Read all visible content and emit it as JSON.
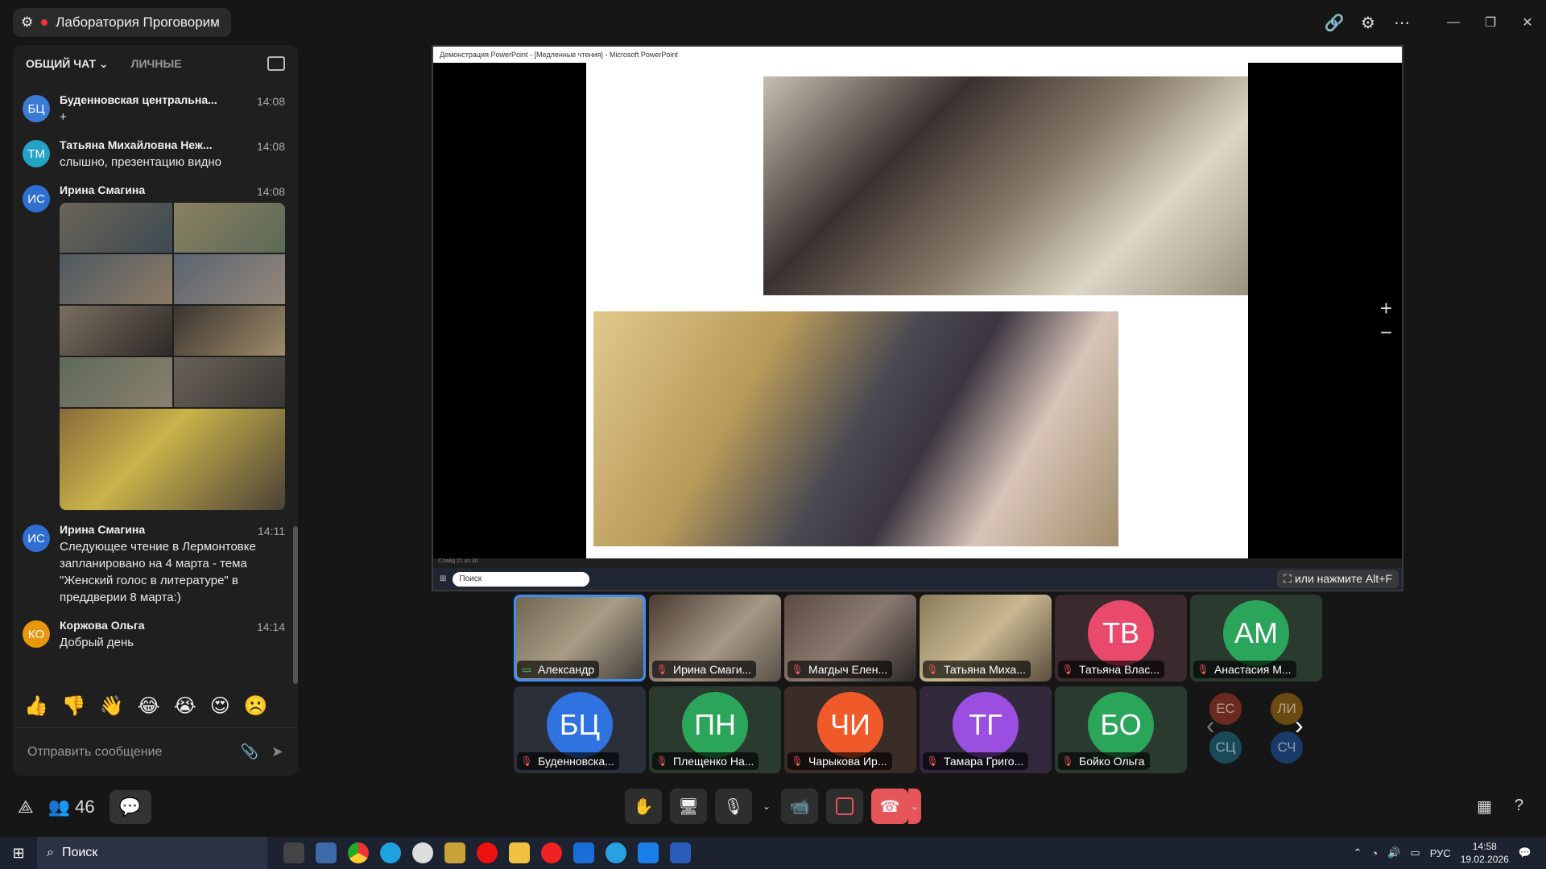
{
  "room": {
    "title": "Лаборатория Проговорим"
  },
  "chat": {
    "tabs": [
      {
        "label": "ОБЩИЙ ЧАТ"
      },
      {
        "label": "ЛИЧНЫЕ"
      }
    ],
    "messages": [
      {
        "initials": "БЦ",
        "name": "Буденновская центральна...",
        "time": "14:08",
        "text": "+",
        "color": "#3a7bd5"
      },
      {
        "initials": "ТМ",
        "name": "Татьяна Михайловна Неж...",
        "time": "14:08",
        "text": "слышно, презентацию видно",
        "color": "#25a3c7"
      },
      {
        "initials": "ИС",
        "name": "Ирина Смагина",
        "time": "14:08",
        "text": "",
        "color": "#2f6fd1"
      },
      {
        "initials": "ИС",
        "name": "Ирина Смагина",
        "time": "14:11",
        "text": "Следующее чтение в Лермонтовке запланировано на 4 марта - тема \"Женский голос в литературе\" в преддверии 8 марта:)",
        "color": "#2f6fd1"
      },
      {
        "initials": "КО",
        "name": "Коржова Ольга",
        "time": "14:14",
        "text": "Добрый день",
        "color": "#e8960c"
      }
    ],
    "reactions": [
      "👍",
      "👎",
      "👋",
      "😂",
      "😭",
      "😍",
      "☹️"
    ],
    "composer_placeholder": "Отправить сообщение"
  },
  "share": {
    "window_title": "Демонстрация PowerPoint - [Медленные чтения] - Microsoft PowerPoint",
    "status": "Слайд 21 из 30",
    "taskbar_search": "Поиск",
    "hint": "или нажмите Alt+F"
  },
  "participants": [
    {
      "name": "Александр",
      "type": "video",
      "icon": "screen"
    },
    {
      "name": "Ирина Смаги...",
      "type": "video",
      "icon": "mic-off"
    },
    {
      "name": "Магдыч Елен...",
      "type": "video",
      "icon": "mic-off"
    },
    {
      "name": "Татьяна Миха...",
      "type": "video",
      "icon": "mic-off"
    },
    {
      "name": "Татьяна Влас...",
      "type": "avatar",
      "initials": "ТВ",
      "color": "#e94a6b",
      "icon": "mic-off"
    },
    {
      "name": "Анастасия М...",
      "type": "avatar",
      "initials": "АМ",
      "color": "#2aa55a",
      "icon": "mic-off"
    },
    {
      "name": "Буденновска...",
      "type": "avatar",
      "initials": "БЦ",
      "color": "#2f73e0",
      "icon": "mic-off"
    },
    {
      "name": "Плещенко На...",
      "type": "avatar",
      "initials": "ПН",
      "color": "#2aa55a",
      "icon": "mic-off"
    },
    {
      "name": "Чарыкова Ир...",
      "type": "avatar",
      "initials": "ЧИ",
      "color": "#f05a2a",
      "icon": "mic-off"
    },
    {
      "name": "Тамара Григо...",
      "type": "avatar",
      "initials": "ТГ",
      "color": "#9b4fe0",
      "icon": "mic-off"
    },
    {
      "name": "Бойко Ольга",
      "type": "avatar",
      "initials": "БО",
      "color": "#2aa55a",
      "icon": "mic-off"
    }
  ],
  "overflow": [
    "ЕС",
    "ЛИ",
    "СЦ",
    "СЧ"
  ],
  "participants_count": "46",
  "taskbar": {
    "search": "Поиск",
    "lang": "РУС",
    "time": "14:58",
    "date": "19.02.2026"
  }
}
